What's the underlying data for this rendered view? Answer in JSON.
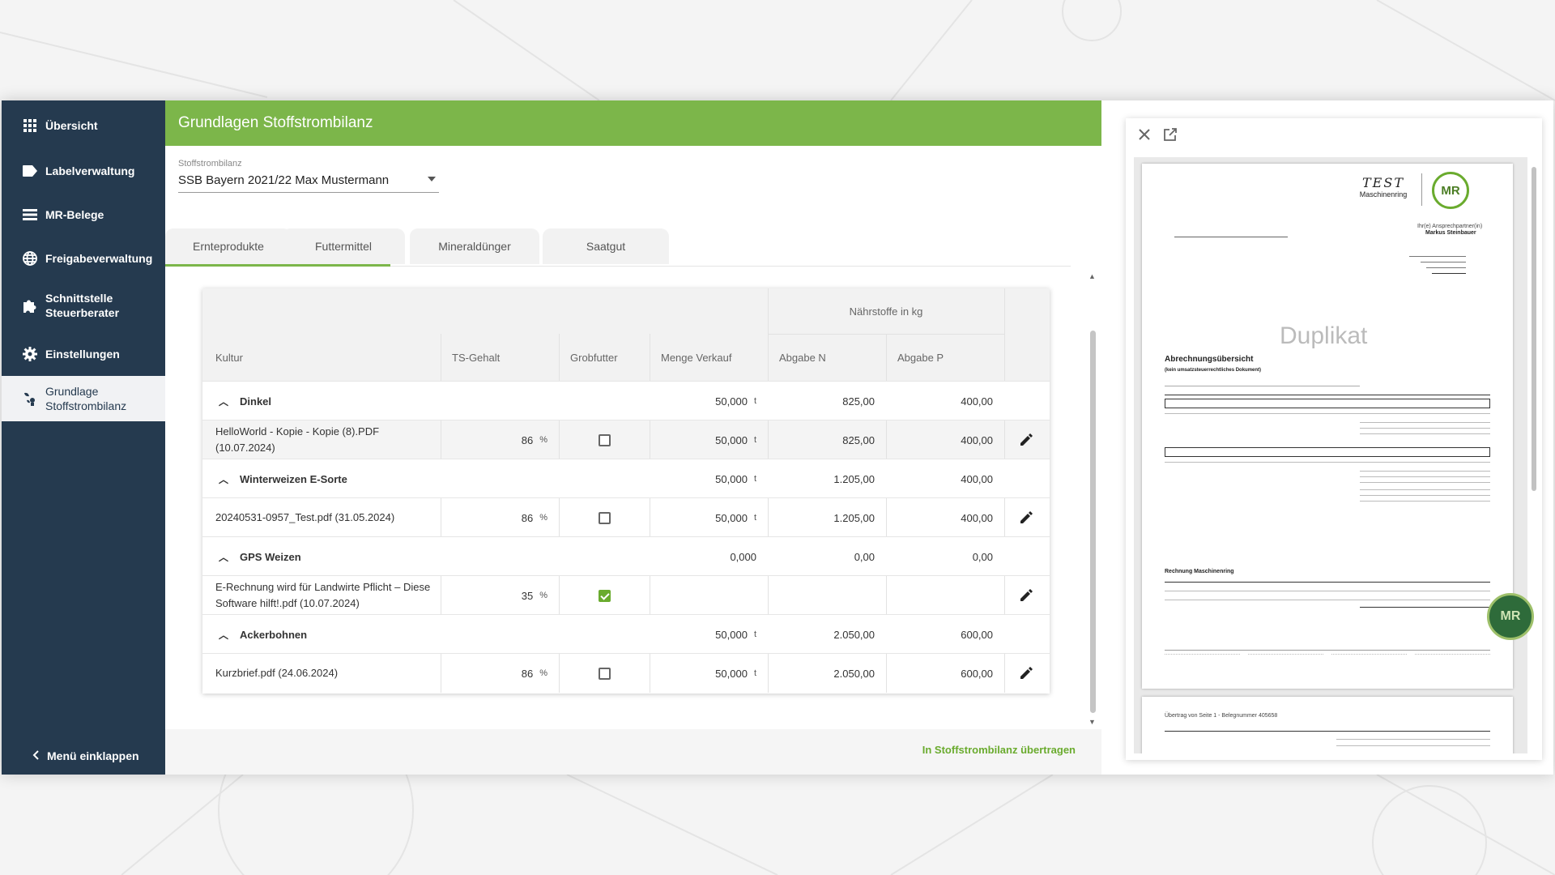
{
  "colors": {
    "sidebar_bg": "#253a4f",
    "header_green": "#7cb64a",
    "accent_green": "#6aab2e"
  },
  "sidebar": {
    "items": [
      {
        "label": "Übersicht",
        "icon": "grid-icon"
      },
      {
        "label": "Labelverwaltung",
        "icon": "label-icon"
      },
      {
        "label": "MR-Belege",
        "icon": "list-icon"
      },
      {
        "label": "Freigabeverwaltung",
        "icon": "globe-icon"
      },
      {
        "label": "Schnittstelle Steuerberater",
        "icon": "puzzle-icon"
      },
      {
        "label": "Einstellungen",
        "icon": "gear-icon"
      },
      {
        "label": "Grundlage Stoffstrombilanz",
        "icon": "plant-icon",
        "active": true
      }
    ],
    "collapse_label": "Menü einklappen"
  },
  "main": {
    "title": "Grundlagen Stoffstrombilanz",
    "select": {
      "label": "Stoffstrombilanz",
      "value": "SSB Bayern 2021/22 Max Mustermann"
    },
    "tabs": [
      "Ernteprodukte",
      "Futtermittel",
      "Mineraldünger",
      "Saatgut"
    ],
    "active_tab": "Ernteprodukte",
    "table": {
      "group_header": "Nährstoffe in kg",
      "columns": [
        "Kultur",
        "TS-Gehalt",
        "Grobfutter",
        "Menge Verkauf",
        "Abgabe N",
        "Abgabe P"
      ],
      "rows": [
        {
          "type": "group",
          "name": "Dinkel",
          "menge": "50,000",
          "menge_unit": "t",
          "n": "825,00",
          "p": "400,00"
        },
        {
          "type": "doc",
          "name": "HelloWorld - Kopie - Kopie (8).PDF (10.07.2024)",
          "ts": "86",
          "ts_unit": "%",
          "grob": false,
          "menge": "50,000",
          "menge_unit": "t",
          "n": "825,00",
          "p": "400,00"
        },
        {
          "type": "group",
          "name": "Winterweizen E-Sorte",
          "menge": "50,000",
          "menge_unit": "t",
          "n": "1.205,00",
          "p": "400,00"
        },
        {
          "type": "doc",
          "name": "20240531-0957_Test.pdf (31.05.2024)",
          "ts": "86",
          "ts_unit": "%",
          "grob": false,
          "menge": "50,000",
          "menge_unit": "t",
          "n": "1.205,00",
          "p": "400,00"
        },
        {
          "type": "group",
          "name": "GPS Weizen",
          "menge": "0,000",
          "menge_unit": "",
          "n": "0,00",
          "p": "0,00"
        },
        {
          "type": "doc",
          "name": "E-Rechnung wird für Landwirte Pflicht – Diese Software hilft!.pdf (10.07.2024)",
          "ts": "35",
          "ts_unit": "%",
          "grob": true,
          "menge": "",
          "menge_unit": "",
          "n": "",
          "p": ""
        },
        {
          "type": "group",
          "name": "Ackerbohnen",
          "menge": "50,000",
          "menge_unit": "t",
          "n": "2.050,00",
          "p": "600,00"
        },
        {
          "type": "doc",
          "name": "Kurzbrief.pdf (24.06.2024)",
          "ts": "86",
          "ts_unit": "%",
          "grob": false,
          "menge": "50,000",
          "menge_unit": "t",
          "n": "2.050,00",
          "p": "600,00"
        }
      ]
    },
    "transfer_label": "In Stoffstrombilanz übertragen"
  },
  "preview": {
    "logo_text": "TEST",
    "logo_sub": "Maschinenring",
    "mr_logo": "MR",
    "contact_label": "Ihr(e) Ansprechpartner(in)",
    "contact_name": "Markus Steinbauer",
    "stamp": "Duplikat",
    "doc_title": "Abrechnungsübersicht",
    "doc_subtitle": "(kein umsatzsteuerrechtliches Dokument)",
    "section_title": "Rechnung Maschinenring",
    "page2_header": "Übertrag von Seite 1 - Belegnummer 405658"
  }
}
